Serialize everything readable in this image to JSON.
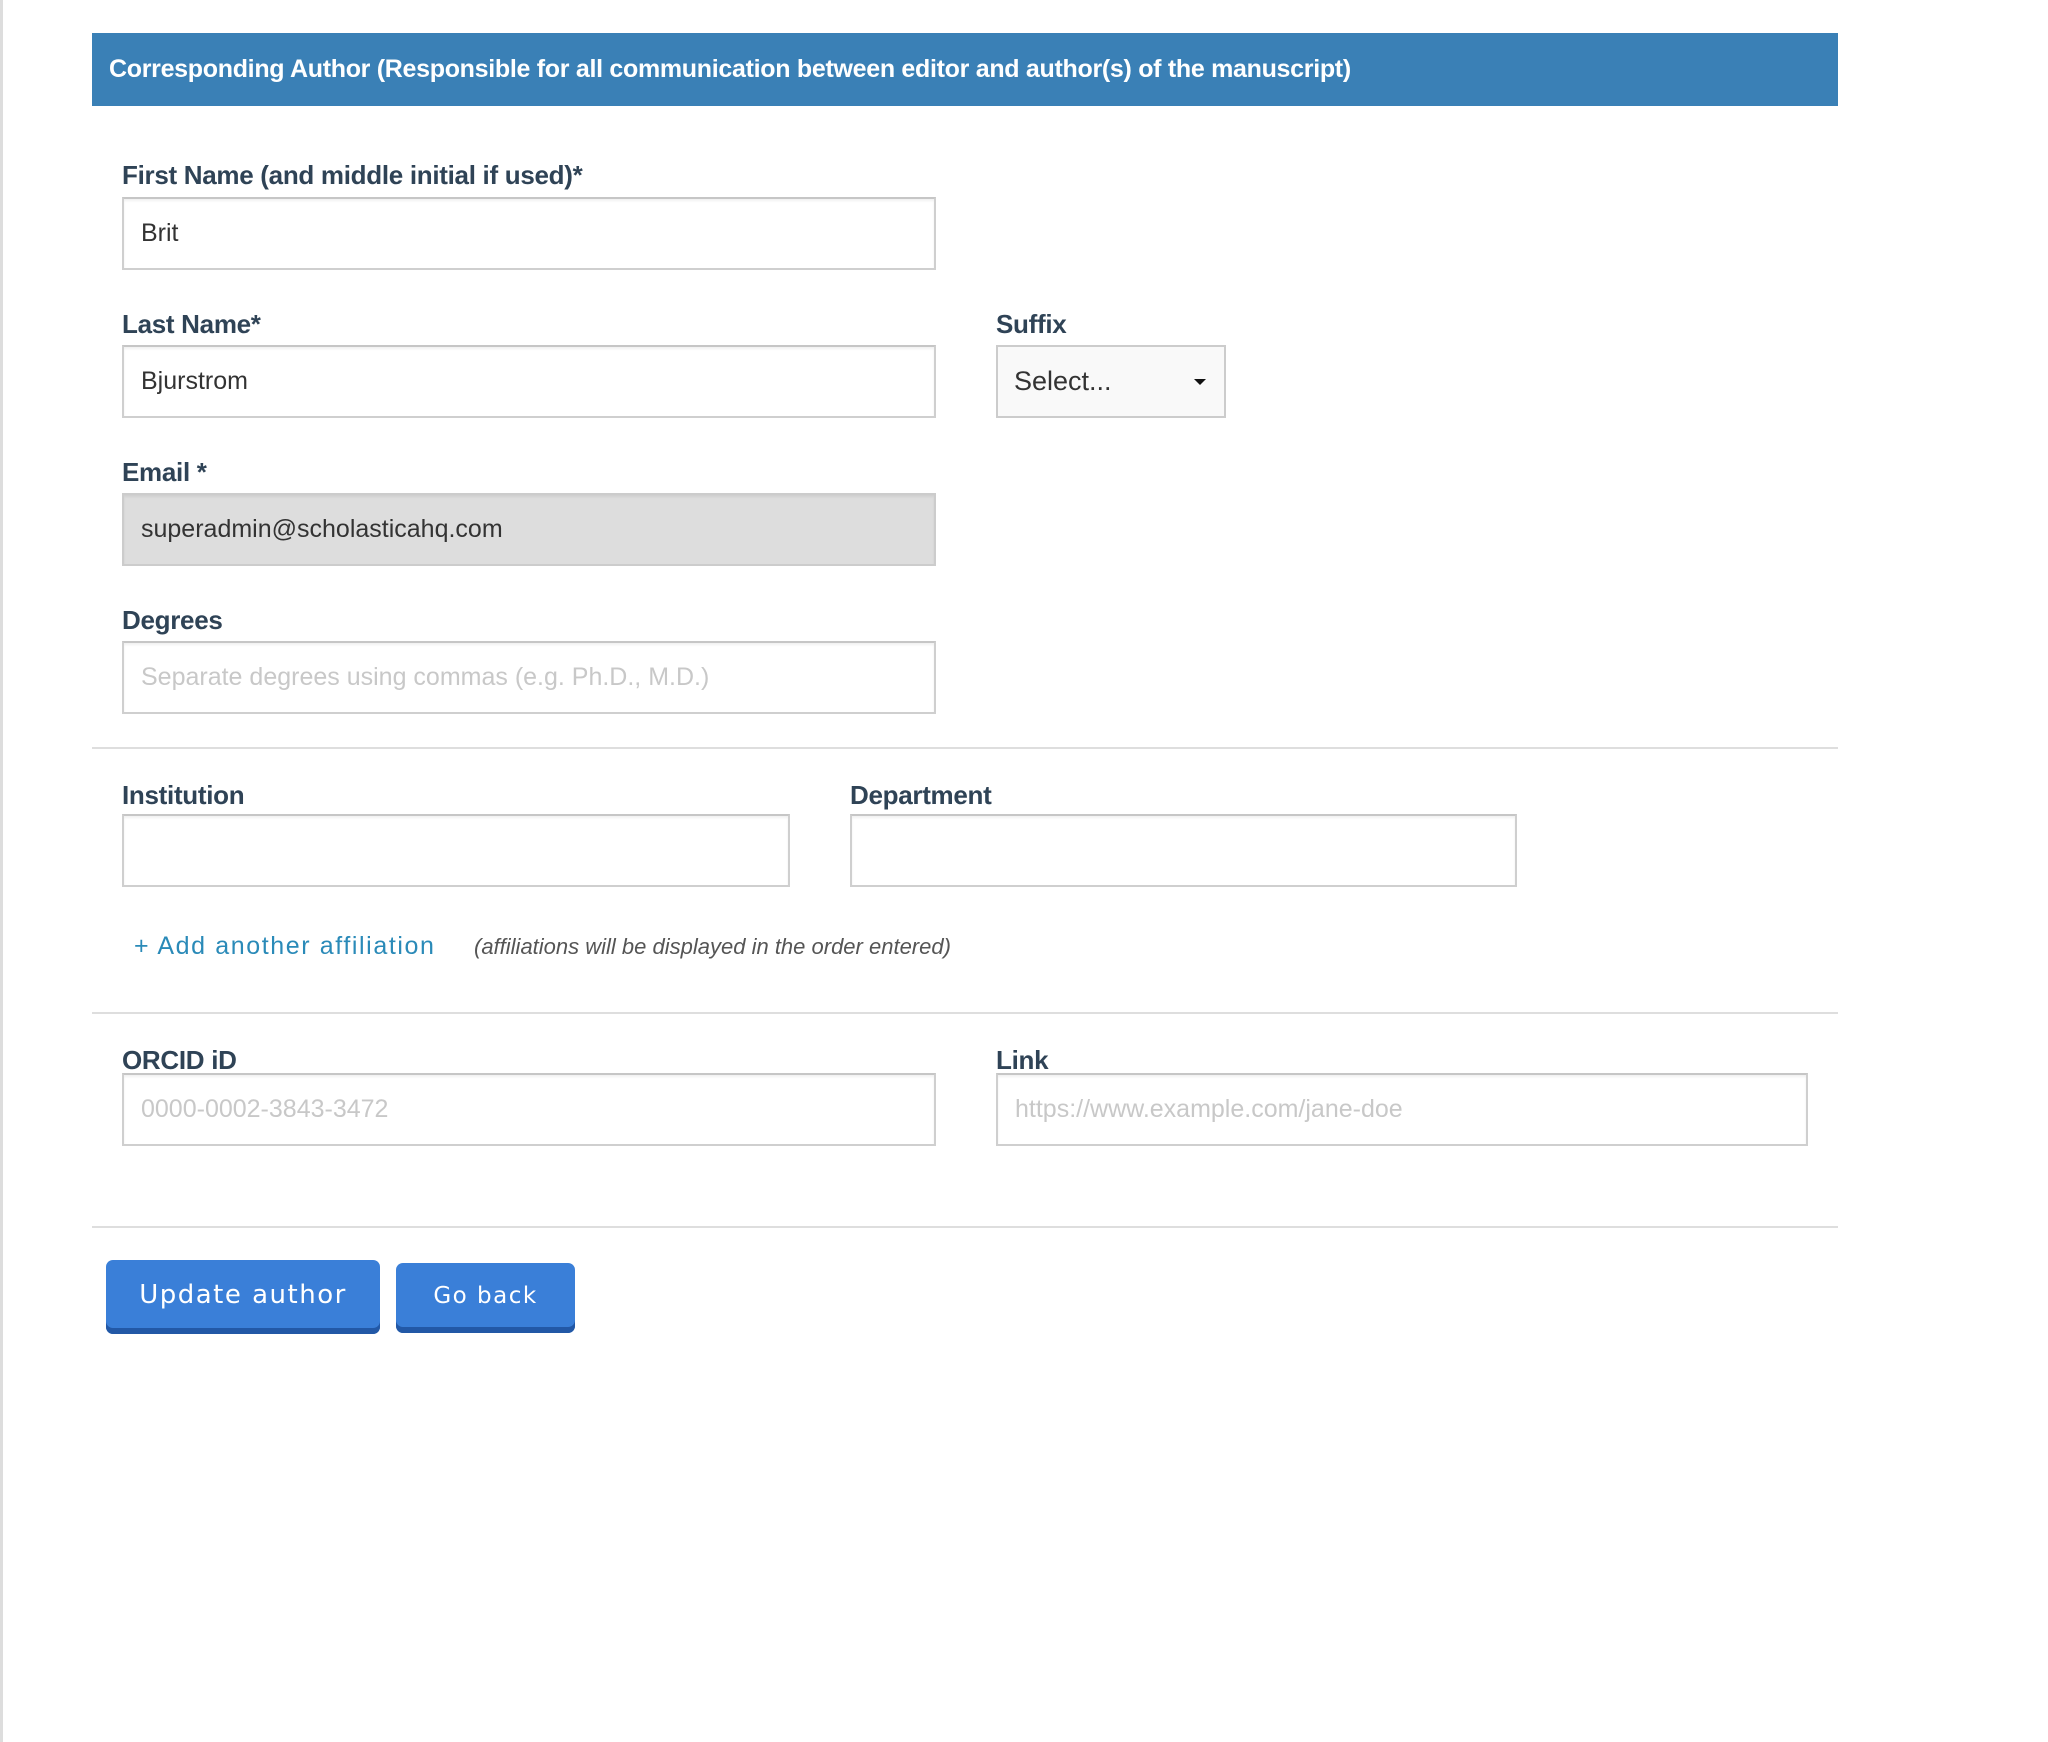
{
  "header": {
    "title": "Corresponding Author (Responsible for all communication between editor and author(s) of the manuscript)"
  },
  "fields": {
    "first_name": {
      "label": "First Name (and middle initial if used)*",
      "value": "Brit",
      "placeholder": ""
    },
    "last_name": {
      "label": "Last Name*",
      "value": "Bjurstrom",
      "placeholder": ""
    },
    "suffix": {
      "label": "Suffix",
      "selected": "Select..."
    },
    "email": {
      "label": "Email *",
      "value": "superadmin@scholasticahq.com",
      "disabled": true
    },
    "degrees": {
      "label": "Degrees",
      "value": "",
      "placeholder": "Separate degrees using commas (e.g. Ph.D., M.D.)"
    },
    "institution": {
      "label": "Institution",
      "value": ""
    },
    "department": {
      "label": "Department",
      "value": ""
    },
    "orcid": {
      "label": "ORCID iD",
      "value": "",
      "placeholder": "0000-0002-3843-3472"
    },
    "link": {
      "label": "Link",
      "value": "",
      "placeholder": "https://www.example.com/jane-doe"
    }
  },
  "affiliation": {
    "add_label": "+ Add another affiliation",
    "hint": "(affiliations will be displayed in the order entered)"
  },
  "actions": {
    "update_label": "Update author",
    "back_label": "Go back"
  },
  "colors": {
    "header_bg": "#3a80b6",
    "button_bg": "#3a7fd8",
    "link": "#2a8ab8"
  }
}
